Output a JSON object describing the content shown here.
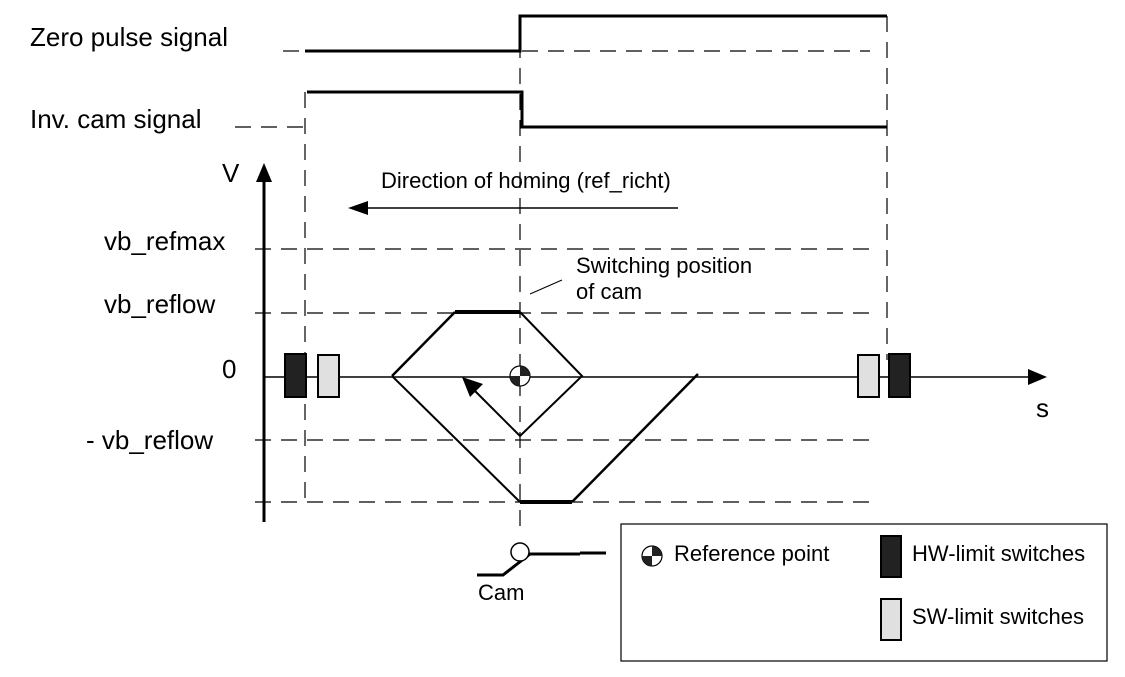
{
  "signals": {
    "zero_pulse": "Zero pulse signal",
    "inv_cam": "Inv. cam signal"
  },
  "axes": {
    "y_label": "V",
    "x_label": "s",
    "zero": "0"
  },
  "levels": {
    "refmax": "vb_refmax",
    "reflow": "vb_reflow",
    "neg_reflow": "- vb_reflow"
  },
  "direction_label": "Direction of homing (ref_richt)",
  "switching_label": {
    "line1": "Switching position",
    "line2": "of cam"
  },
  "cam_label": "Cam",
  "legend": {
    "reference_point": "Reference point",
    "hw_limit": "HW-limit switches",
    "sw_limit": "SW-limit switches"
  },
  "colors": {
    "hw": "#222222",
    "sw": "#e0e0e0"
  }
}
